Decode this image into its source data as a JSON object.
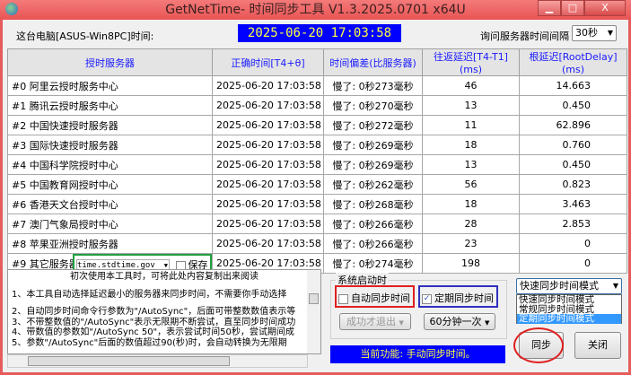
{
  "window": {
    "title": "GetNetTime- 时间同步工具 V1.3.2025.0701 x64U",
    "minimize": "▁",
    "maximize": "□",
    "close": "X"
  },
  "header": {
    "pc_label": "这台电脑[ASUS-Win8PC]时间:",
    "clock": "2025-06-20  17:03:58",
    "interval_label": "询问服务器时间间隔",
    "interval_value": "30秒"
  },
  "table": {
    "columns": [
      "授时服务器",
      "正确时间[T4+θ]",
      "时间偏差(比服务器)",
      "往返延迟[T4-T1](ms)",
      "根延迟[RootDelay](ms)"
    ],
    "rows": [
      {
        "server": "#0 阿里云授时服务中心",
        "time": "2025-06-20  17:03:58",
        "offset": "慢了: 0秒273毫秒",
        "rtt": "46",
        "root": "14.663"
      },
      {
        "server": "#1 腾讯云授时服务中心",
        "time": "2025-06-20  17:03:58",
        "offset": "慢了: 0秒270毫秒",
        "rtt": "13",
        "root": "0.450"
      },
      {
        "server": "#2 中国快速授时服务器",
        "time": "2025-06-20  17:03:58",
        "offset": "慢了: 0秒272毫秒",
        "rtt": "11",
        "root": "62.896"
      },
      {
        "server": "#3 国际快速授时服务器",
        "time": "2025-06-20  17:03:58",
        "offset": "慢了: 0秒269毫秒",
        "rtt": "18",
        "root": "0.760"
      },
      {
        "server": "#4 中国科学院授时中心",
        "time": "2025-06-20  17:03:58",
        "offset": "慢了: 0秒269毫秒",
        "rtt": "13",
        "root": "0.450"
      },
      {
        "server": "#5 中国教育网授时中心",
        "time": "2025-06-20  17:03:58",
        "offset": "慢了: 0秒262毫秒",
        "rtt": "56",
        "root": "0.823"
      },
      {
        "server": "#6 香港天文台授时中心",
        "time": "2025-06-20  17:03:58",
        "offset": "慢了: 0秒268毫秒",
        "rtt": "18",
        "root": "3.463"
      },
      {
        "server": "#7 澳门气象局授时中心",
        "time": "2025-06-20  17:03:58",
        "offset": "慢了: 0秒266毫秒",
        "rtt": "28",
        "root": "2.853"
      },
      {
        "server": "#8 苹果亚洲授时服务器",
        "time": "2025-06-20  17:03:58",
        "offset": "慢了: 0秒266毫秒",
        "rtt": "23",
        "root": "0"
      }
    ],
    "custom": {
      "label": "#9 其它服务器",
      "host": "time.stdtime.gov",
      "save": "保存",
      "time": "2025-06-20  17:03:58",
      "offset": "慢了: 0秒274毫秒",
      "rtt": "198",
      "root": "0"
    }
  },
  "readme": {
    "title": "初次使用本工具时，可将此处内容复制出来阅读",
    "lines": [
      "1、本工具自动选择延迟最小的服务器来同步时间，不需要你手动选择",
      "2、自动同步时间命令行参数为\"/AutoSync\"，后面可带整数数值表示等",
      "3、不带整数值的\"/AutoSync\"表示无限期不断尝试，直至同步时间成功",
      "4、带数值的参数如\"/AutoSync 50\"，表示尝试时间50秒，尝试期间成",
      "5、参数\"/AutoSync\"后面的数值超过90(秒)时，会自动转换为无限期"
    ]
  },
  "startup": {
    "group": "系统启动时",
    "auto_sync": "自动同步时间",
    "auto_checked": false,
    "periodic_sync": "定期同步时间",
    "periodic_checked": true,
    "exit_option": "成功才退出",
    "period": "60分钟一次"
  },
  "status": "当前功能: 手动同步时间。",
  "mode": {
    "selected": "快速同步时间模式",
    "options": [
      "快速同步时间模式",
      "常规同步时间模式",
      "定期同步时间模式"
    ],
    "highlighted": 2
  },
  "buttons": {
    "sync": "同步",
    "close": "关闭"
  }
}
